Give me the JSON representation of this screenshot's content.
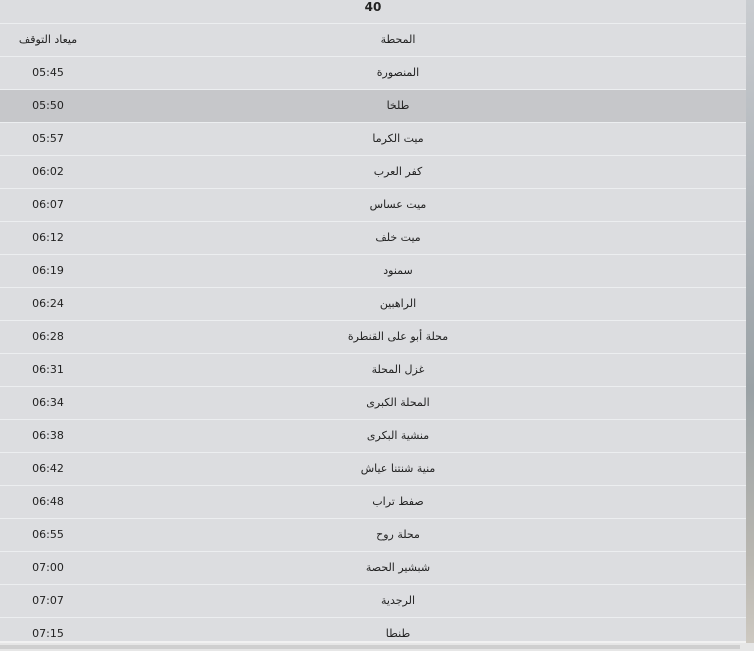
{
  "table": {
    "top_number": "40",
    "headers": {
      "station": "المحطة",
      "time": "ميعاد التوقف"
    },
    "rows": [
      {
        "station": "المنصورة",
        "time": "05:45",
        "selected": false
      },
      {
        "station": "طلخا",
        "time": "05:50",
        "selected": true
      },
      {
        "station": "ميت الكرما",
        "time": "05:57",
        "selected": false
      },
      {
        "station": "كفر العرب",
        "time": "06:02",
        "selected": false
      },
      {
        "station": "ميت عساس",
        "time": "06:07",
        "selected": false
      },
      {
        "station": "ميت خلف",
        "time": "06:12",
        "selected": false
      },
      {
        "station": "سمنود",
        "time": "06:19",
        "selected": false
      },
      {
        "station": "الراهبين",
        "time": "06:24",
        "selected": false
      },
      {
        "station": "محلة أبو على القنطرة",
        "time": "06:28",
        "selected": false
      },
      {
        "station": "غزل المحلة",
        "time": "06:31",
        "selected": false
      },
      {
        "station": "المحلة الكبرى",
        "time": "06:34",
        "selected": false
      },
      {
        "station": "منشية البكرى",
        "time": "06:38",
        "selected": false
      },
      {
        "station": "منية شنتنا عياش",
        "time": "06:42",
        "selected": false
      },
      {
        "station": "صفط تراب",
        "time": "06:48",
        "selected": false
      },
      {
        "station": "محلة روح",
        "time": "06:55",
        "selected": false
      },
      {
        "station": "شبشير الحصة",
        "time": "07:00",
        "selected": false
      },
      {
        "station": "الرجدية",
        "time": "07:07",
        "selected": false
      },
      {
        "station": "طنطا",
        "time": "07:15",
        "selected": false
      }
    ]
  }
}
